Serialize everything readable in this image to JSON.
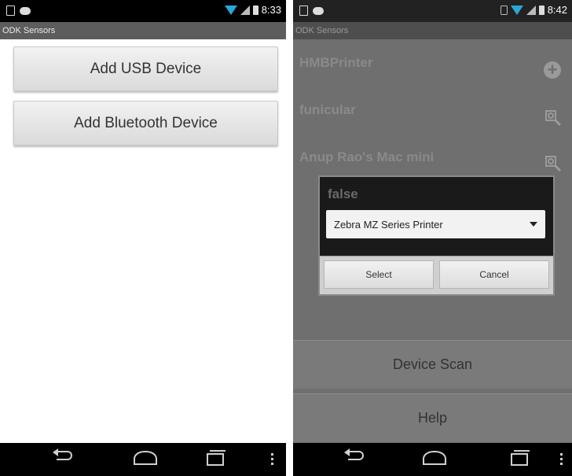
{
  "left_screen": {
    "status_time": "8:33",
    "app_title": "ODK Sensors",
    "buttons": {
      "add_usb": "Add USB Device",
      "add_bluetooth": "Add Bluetooth Device"
    }
  },
  "right_screen": {
    "status_time": "8:42",
    "app_title": "ODK Sensors",
    "devices": [
      {
        "name": "HMBPrinter",
        "icon": "add-circle-icon"
      },
      {
        "name": "funicular",
        "icon": "search-icon"
      },
      {
        "name": "Anup Rao's Mac mini",
        "icon": "search-icon"
      }
    ],
    "dialog": {
      "title": "false",
      "selected_option": "Zebra MZ Series Printer",
      "select_label": "Select",
      "cancel_label": "Cancel"
    },
    "bottom_buttons": {
      "device_scan": "Device Scan",
      "help": "Help"
    }
  },
  "colors": {
    "wifi_accent": "#2aa7d9",
    "title_bar": "#5d5d5d",
    "dim_overlay": "#6f6f6f"
  }
}
